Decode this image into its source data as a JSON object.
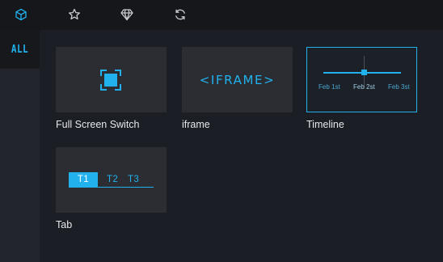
{
  "topbar": {
    "tabs": [
      {
        "icon": "cube-icon",
        "active": true
      },
      {
        "icon": "star-icon",
        "active": false
      },
      {
        "icon": "diamond-icon",
        "active": false
      },
      {
        "icon": "refresh-icon",
        "active": false
      }
    ]
  },
  "sidebar": {
    "items": [
      {
        "label": "ALL",
        "active": true
      }
    ]
  },
  "components": [
    {
      "label": "Full Screen Switch",
      "preview_icon": "fullscreen-icon"
    },
    {
      "label": "iframe",
      "preview_text": "<IFRAME>"
    },
    {
      "label": "Timeline",
      "selected": true,
      "dates": [
        "Feb 1st",
        "Feb 2st",
        "Feb 3st"
      ]
    },
    {
      "label": "Tab",
      "tabs": [
        "T1",
        "T2",
        "T3"
      ]
    }
  ],
  "colors": {
    "accent": "#21b2ee",
    "icon_inactive": "#c9ccd1",
    "background": "#1b1e24",
    "topbar": "#15171b",
    "card": "#2b2d33"
  }
}
